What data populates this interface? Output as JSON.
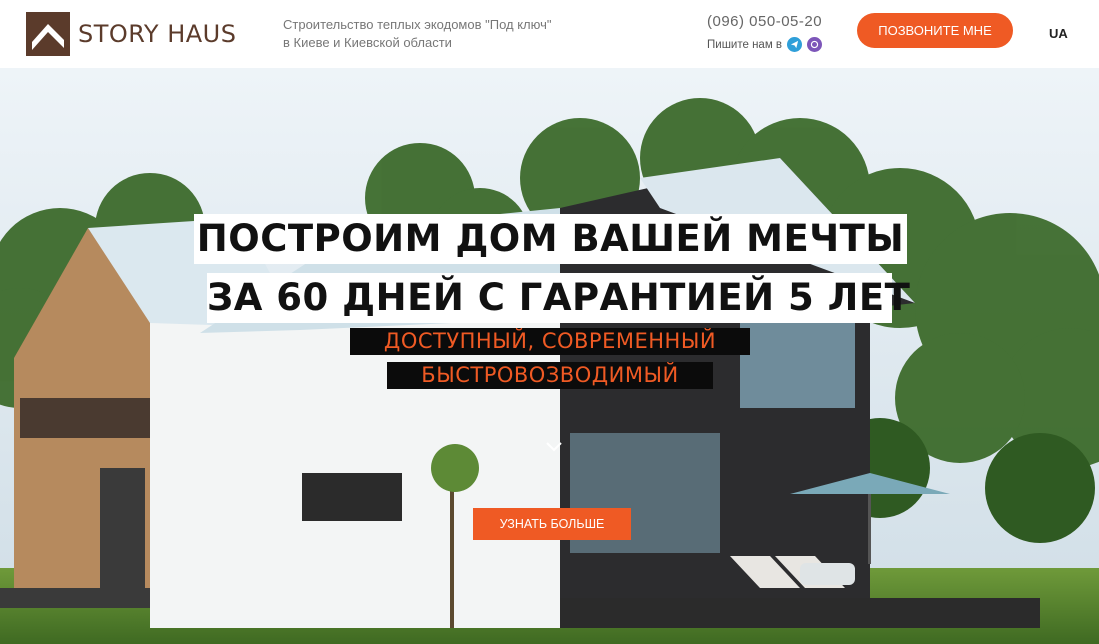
{
  "header": {
    "logo_text": "STORY HAUS",
    "tagline_line1": "Строительство теплых экодомов \"Под ключ\"",
    "tagline_line2": "в Киеве и Киевской области",
    "phone": "(096) 050-05-20",
    "write_us": "Пишите нам в",
    "messengers": [
      "telegram-icon",
      "viber-icon"
    ],
    "call_button": "ПОЗВОНИТЕ МНЕ",
    "language": "UA"
  },
  "hero": {
    "headline_line1": "ПОСТРОИМ ДОМ ВАШЕЙ МЕЧТЫ",
    "headline_line2": "ЗА 60 ДНЕЙ С ГАРАНТИЕЙ 5 ЛЕТ",
    "sub_line1": "ДОСТУПНЫЙ, СОВРЕМЕННЫЙ",
    "sub_line2": "БЫСТРОВОЗВОДИМЫЙ",
    "more_button": "УЗНАТЬ БОЛЬШЕ",
    "scroll_icon": "chevron-down-icon"
  },
  "colors": {
    "brand_brown": "#5b3b2b",
    "accent_orange": "#ef5a24",
    "text_gray": "#777777"
  }
}
